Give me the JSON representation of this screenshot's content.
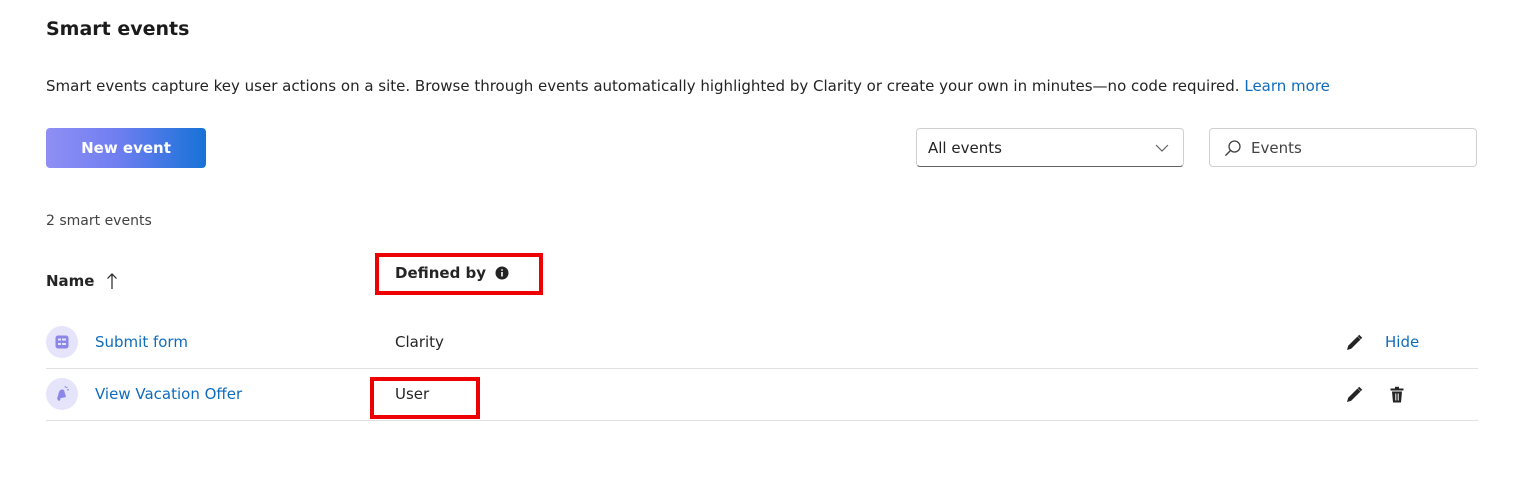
{
  "page": {
    "title": "Smart events",
    "description": "Smart events capture key user actions on a site. Browse through events automatically highlighted by Clarity or create your own in minutes—no code required.",
    "learn_more": "Learn more"
  },
  "toolbar": {
    "new_event_label": "New event",
    "filter_value": "All events",
    "search_placeholder": "Events"
  },
  "table": {
    "count_label": "2 smart events",
    "columns": {
      "name": "Name",
      "defined_by": "Defined by"
    },
    "sort": "ascending",
    "rows": [
      {
        "name": "Submit form",
        "defined_by": "Clarity",
        "icon": "form-icon",
        "action_label": "Hide"
      },
      {
        "name": "View Vacation Offer",
        "defined_by": "User",
        "icon": "bell-icon"
      }
    ]
  },
  "colors": {
    "accent": "#0f6cbd",
    "highlight": "#ee0000",
    "icon_bg": "#e6e4fb"
  }
}
